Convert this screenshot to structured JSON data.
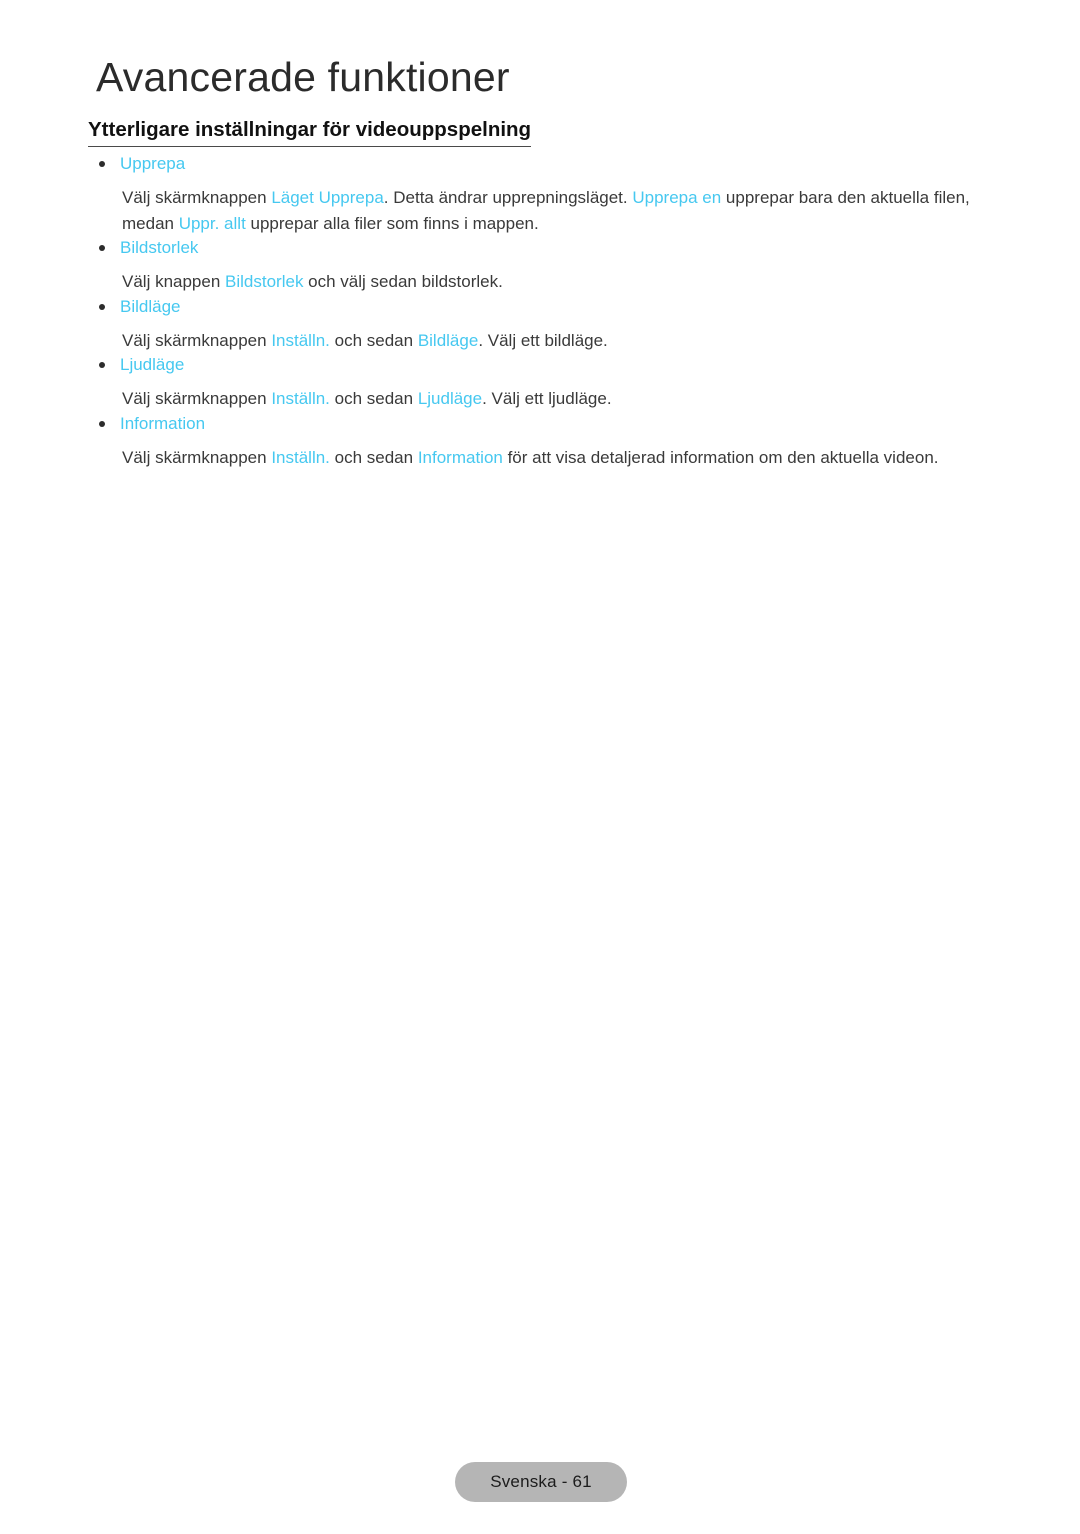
{
  "document": {
    "chapter_title": "Avancerade funktioner",
    "section_title": "Ytterligare inställningar för videouppspelning"
  },
  "sections": [
    {
      "bullet_label": "Upprepa",
      "paragraph": {
        "parts": [
          {
            "text": "Välj skärmknappen ",
            "highlight": false
          },
          {
            "text": "Läget Upprepa",
            "highlight": true
          },
          {
            "text": ". Detta ändrar upprepningsläget. ",
            "highlight": false
          },
          {
            "text": "Upprepa en",
            "highlight": true
          },
          {
            "text": " upprepar bara den aktuella filen, medan ",
            "highlight": false
          },
          {
            "text": "Uppr. allt",
            "highlight": true
          },
          {
            "text": " upprepar alla filer som finns i mappen.",
            "highlight": false
          }
        ],
        "plain": "Välj skärmknappen Läget Upprepa. Detta ändrar upprepningsläget. Upprepa en upprepar bara den aktuella filen, medan Uppr. allt upprepar alla filer som finns i mappen."
      }
    },
    {
      "bullet_label": "Bildstorlek",
      "paragraph": {
        "parts": [
          {
            "text": "Välj knappen ",
            "highlight": false
          },
          {
            "text": "Bildstorlek",
            "highlight": true
          },
          {
            "text": " och välj sedan bildstorlek.",
            "highlight": false
          }
        ],
        "plain": "Välj knappen Bildstorlek och välj sedan bildstorlek."
      }
    },
    {
      "bullet_label": "Bildläge",
      "paragraph": {
        "parts": [
          {
            "text": "Välj skärmknappen ",
            "highlight": false
          },
          {
            "text": "Inställn.",
            "highlight": true
          },
          {
            "text": " och sedan ",
            "highlight": false
          },
          {
            "text": "Bildläge",
            "highlight": true
          },
          {
            "text": ". Välj ett bildläge.",
            "highlight": false
          }
        ],
        "plain": "Välj skärmknappen Inställn. och sedan Bildläge. Välj ett bildläge."
      }
    },
    {
      "bullet_label": "Ljudläge",
      "paragraph": {
        "parts": [
          {
            "text": "Välj skärmknappen ",
            "highlight": false
          },
          {
            "text": "Inställn.",
            "highlight": true
          },
          {
            "text": " och sedan ",
            "highlight": false
          },
          {
            "text": "Ljudläge",
            "highlight": true
          },
          {
            "text": ". Välj ett ljudläge.",
            "highlight": false
          }
        ],
        "plain": "Välj skärmknappen Inställn. och sedan Ljudläge. Välj ett ljudläge."
      }
    },
    {
      "bullet_label": "Information",
      "paragraph": {
        "parts": [
          {
            "text": "Välj skärmknappen ",
            "highlight": false
          },
          {
            "text": "Inställn.",
            "highlight": true
          },
          {
            "text": " och sedan ",
            "highlight": false
          },
          {
            "text": "Information",
            "highlight": true
          },
          {
            "text": " för att visa detaljerad information om den aktuella videon.",
            "highlight": false
          }
        ],
        "plain": "Välj skärmknappen Inställn. och sedan Information för att visa detaljerad information om den aktuella videon."
      }
    }
  ],
  "footer": {
    "page_label": "Svenska - 61"
  },
  "colors": {
    "highlight": "#46c8f0",
    "body_text": "#3a3a3a",
    "title_text": "#2b2b2b",
    "badge_background": "#b5b5b5",
    "page_background": "#ffffff"
  }
}
